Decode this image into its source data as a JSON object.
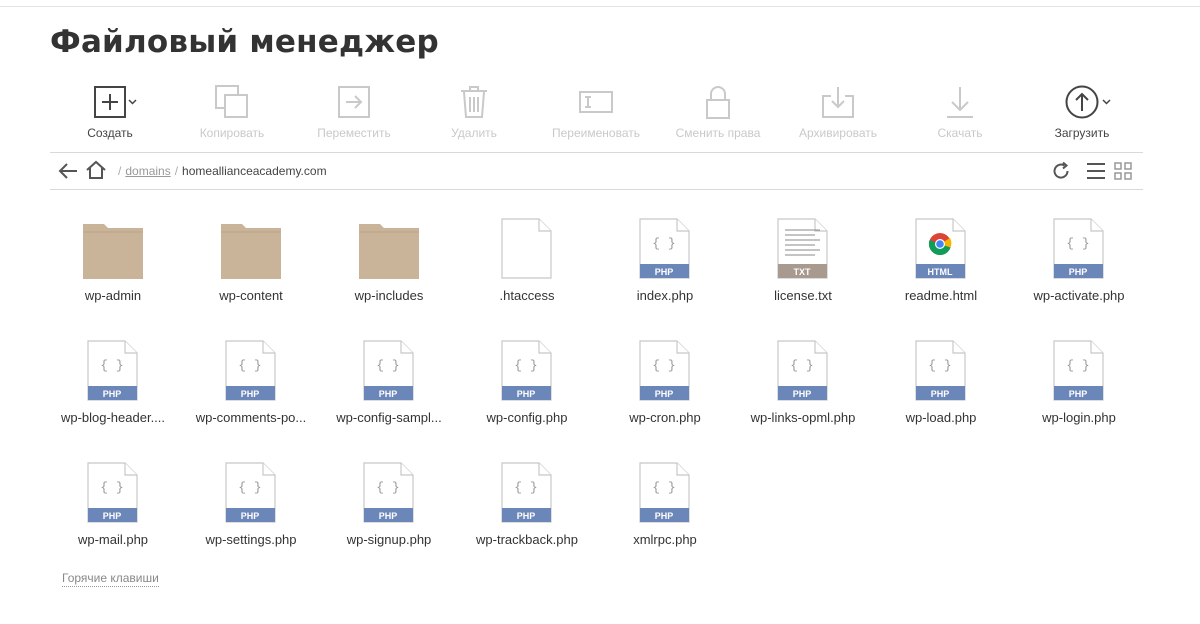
{
  "page": {
    "title": "Файловый менеджер"
  },
  "toolbar": {
    "items": [
      {
        "label": "Создать",
        "icon": "plus-square-icon",
        "active": true,
        "has_dropdown": true
      },
      {
        "label": "Копировать",
        "icon": "copy-icon",
        "active": false
      },
      {
        "label": "Переместить",
        "icon": "move-icon",
        "active": false
      },
      {
        "label": "Удалить",
        "icon": "trash-icon",
        "active": false
      },
      {
        "label": "Переименовать",
        "icon": "rename-icon",
        "active": false
      },
      {
        "label": "Сменить права",
        "icon": "lock-icon",
        "active": false
      },
      {
        "label": "Архивировать",
        "icon": "archive-icon",
        "active": false
      },
      {
        "label": "Скачать",
        "icon": "download-icon",
        "active": false
      },
      {
        "label": "Загрузить",
        "icon": "upload-circle-icon",
        "active": true,
        "has_dropdown": true
      }
    ]
  },
  "navigation": {
    "separator": "/",
    "breadcrumb": [
      {
        "label": "domains",
        "link": true
      },
      {
        "label": "homealliancеacademy.com",
        "link": false
      }
    ]
  },
  "files": [
    {
      "name": "wp-admin",
      "type": "folder"
    },
    {
      "name": "wp-content",
      "type": "folder"
    },
    {
      "name": "wp-includes",
      "type": "folder"
    },
    {
      "name": ".htaccess",
      "type": "blank"
    },
    {
      "name": "index.php",
      "type": "php",
      "badge": "PHP"
    },
    {
      "name": "license.txt",
      "type": "txt",
      "badge": "TXT"
    },
    {
      "name": "readme.html",
      "type": "html",
      "badge": "HTML"
    },
    {
      "name": "wp-activate.php",
      "type": "php",
      "badge": "PHP"
    },
    {
      "name": "wp-blog-header....",
      "type": "php",
      "badge": "PHP"
    },
    {
      "name": "wp-comments-po...",
      "type": "php",
      "badge": "PHP"
    },
    {
      "name": "wp-config-sampl...",
      "type": "php",
      "badge": "PHP"
    },
    {
      "name": "wp-config.php",
      "type": "php",
      "badge": "PHP"
    },
    {
      "name": "wp-cron.php",
      "type": "php",
      "badge": "PHP"
    },
    {
      "name": "wp-links-opml.php",
      "type": "php",
      "badge": "PHP"
    },
    {
      "name": "wp-load.php",
      "type": "php",
      "badge": "PHP"
    },
    {
      "name": "wp-login.php",
      "type": "php",
      "badge": "PHP"
    },
    {
      "name": "wp-mail.php",
      "type": "php",
      "badge": "PHP"
    },
    {
      "name": "wp-settings.php",
      "type": "php",
      "badge": "PHP"
    },
    {
      "name": "wp-signup.php",
      "type": "php",
      "badge": "PHP"
    },
    {
      "name": "wp-trackback.php",
      "type": "php",
      "badge": "PHP"
    },
    {
      "name": "xmlrpc.php",
      "type": "php",
      "badge": "PHP"
    }
  ],
  "footer": {
    "hotkeys_label": "Горячие клавиши"
  },
  "colors": {
    "folder": "#c9b49a",
    "php_badge": "#6b86b8",
    "txt_badge": "#a89a8e",
    "html_badge": "#6b86b8",
    "disabled": "#c9c9c9",
    "active": "#444444"
  }
}
